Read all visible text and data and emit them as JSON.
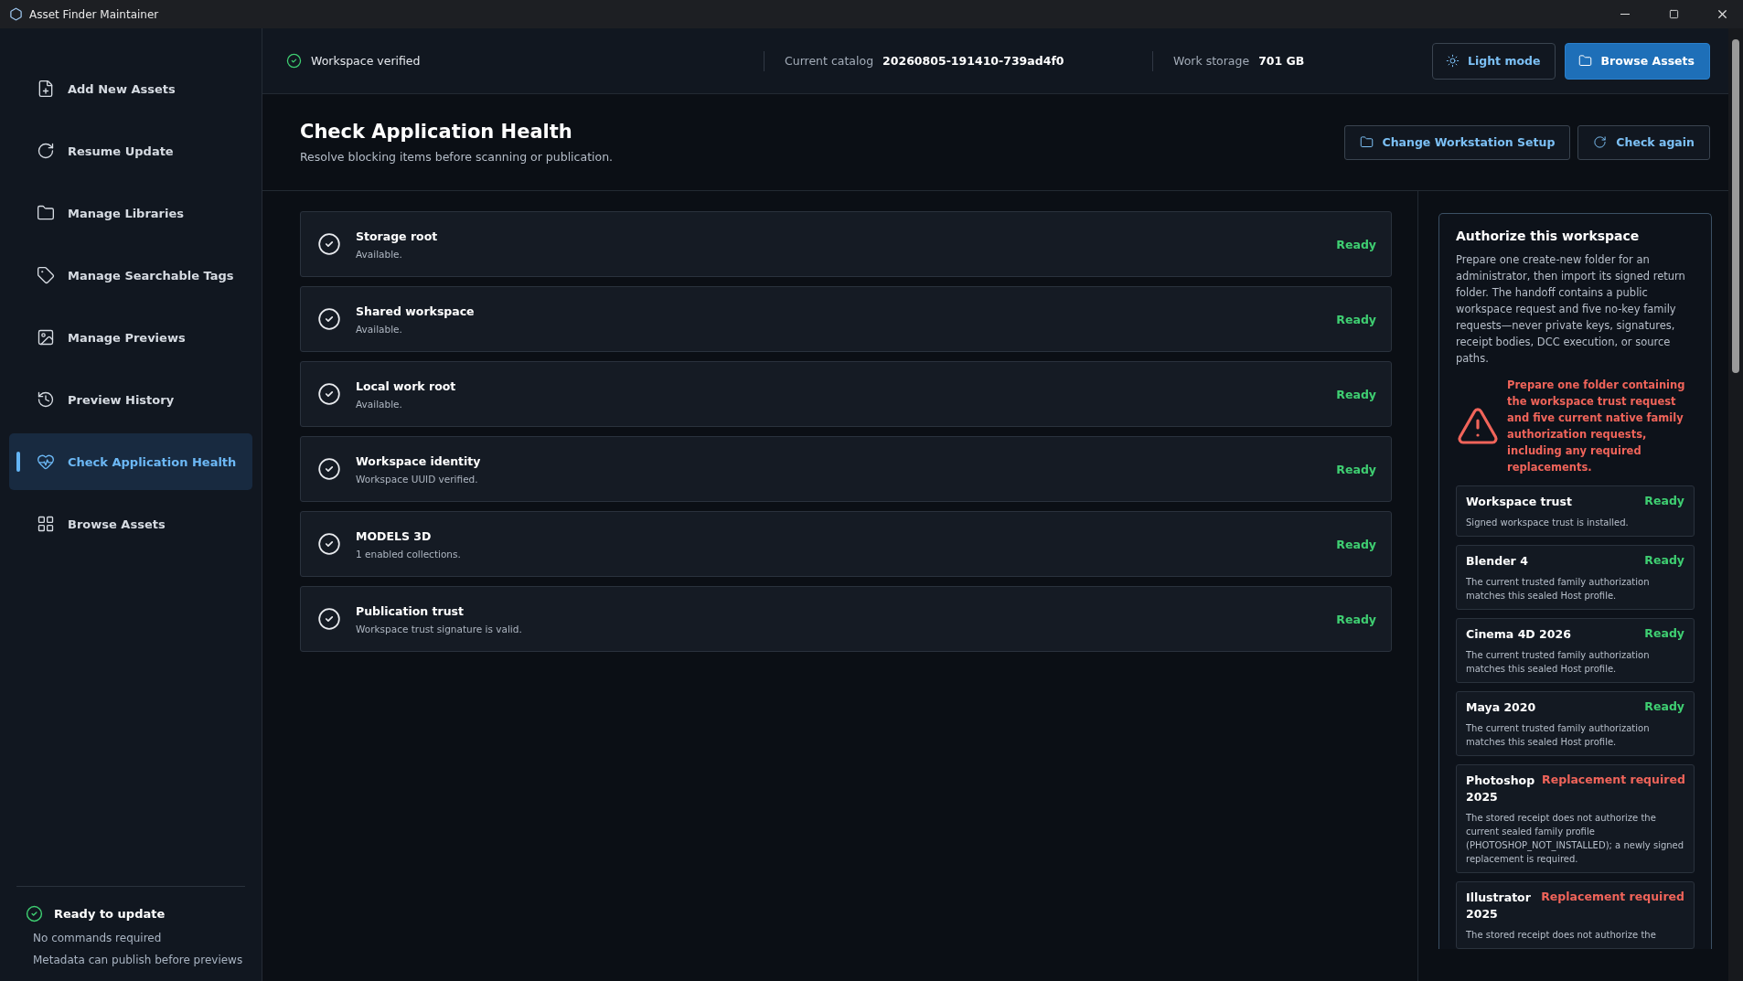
{
  "window": {
    "title": "Asset Finder Maintainer"
  },
  "sidebar": {
    "items": [
      {
        "label": "Add New Assets",
        "selected": false
      },
      {
        "label": "Resume Update",
        "selected": false
      },
      {
        "label": "Manage Libraries",
        "selected": false
      },
      {
        "label": "Manage Searchable Tags",
        "selected": false
      },
      {
        "label": "Manage Previews",
        "selected": false
      },
      {
        "label": "Preview History",
        "selected": false
      },
      {
        "label": "Check Application Health",
        "selected": true
      },
      {
        "label": "Browse Assets",
        "selected": false
      }
    ],
    "footer": {
      "status": "Ready to update",
      "lines": [
        "No commands required",
        "Metadata can publish before previews"
      ]
    }
  },
  "topbar": {
    "verified": "Workspace verified",
    "catalog_label": "Current catalog",
    "catalog": "20260805-191410-739ad4f0",
    "storage_label": "Work storage",
    "storage": "701 GB",
    "buttons": [
      {
        "label": "Light mode",
        "kind": "outline"
      },
      {
        "label": "Browse Assets",
        "kind": "primary"
      }
    ]
  },
  "header": {
    "title": "Check Application Health",
    "subtitle": "Resolve blocking items before scanning or publication.",
    "buttons": [
      {
        "label": "Change Workstation Setup"
      },
      {
        "label": "Check again"
      }
    ]
  },
  "checks": [
    {
      "title": "Storage root",
      "detail": "Available.",
      "status": "Ready",
      "kind": "ready"
    },
    {
      "title": "Shared workspace",
      "detail": "Available.",
      "status": "Ready",
      "kind": "ready"
    },
    {
      "title": "Local work root",
      "detail": "Available.",
      "status": "Ready",
      "kind": "ready"
    },
    {
      "title": "Workspace identity",
      "detail": "Workspace UUID verified.",
      "status": "Ready",
      "kind": "ready"
    },
    {
      "title": "MODELS 3D",
      "detail": "1 enabled collections.",
      "status": "Ready",
      "kind": "ready"
    },
    {
      "title": "Publication trust",
      "detail": "Workspace trust signature is valid.",
      "status": "Ready",
      "kind": "ready"
    }
  ],
  "authorize": {
    "title": "Authorize this workspace",
    "description": "Prepare one create-new folder for an administrator, then import its signed return folder. The handoff contains a public workspace request and five no-key family requests—never private keys, signatures, receipt bodies, DCC execution, or source paths.",
    "warning": "Prepare one folder containing the workspace trust request and five current native family authorization requests, including any required replacements.",
    "items": [
      {
        "title": "Workspace trust",
        "status": "Ready",
        "kind": "ready",
        "detail": "Signed workspace trust is installed."
      },
      {
        "title": "Blender 4",
        "status": "Ready",
        "kind": "ready",
        "detail": "The current trusted family authorization matches this sealed Host profile."
      },
      {
        "title": "Cinema 4D 2026",
        "status": "Ready",
        "kind": "ready",
        "detail": "The current trusted family authorization matches this sealed Host profile."
      },
      {
        "title": "Maya 2020",
        "status": "Ready",
        "kind": "ready",
        "detail": "The current trusted family authorization matches this sealed Host profile."
      },
      {
        "title": "Photoshop 2025",
        "status": "Replacement required",
        "kind": "replacement",
        "detail": "The stored receipt does not authorize the current sealed family profile (PHOTOSHOP_NOT_INSTALLED); a newly signed replacement is required."
      },
      {
        "title": "Illustrator 2025",
        "status": "Replacement required",
        "kind": "replacement",
        "detail": "The stored receipt does not authorize the"
      }
    ]
  }
}
